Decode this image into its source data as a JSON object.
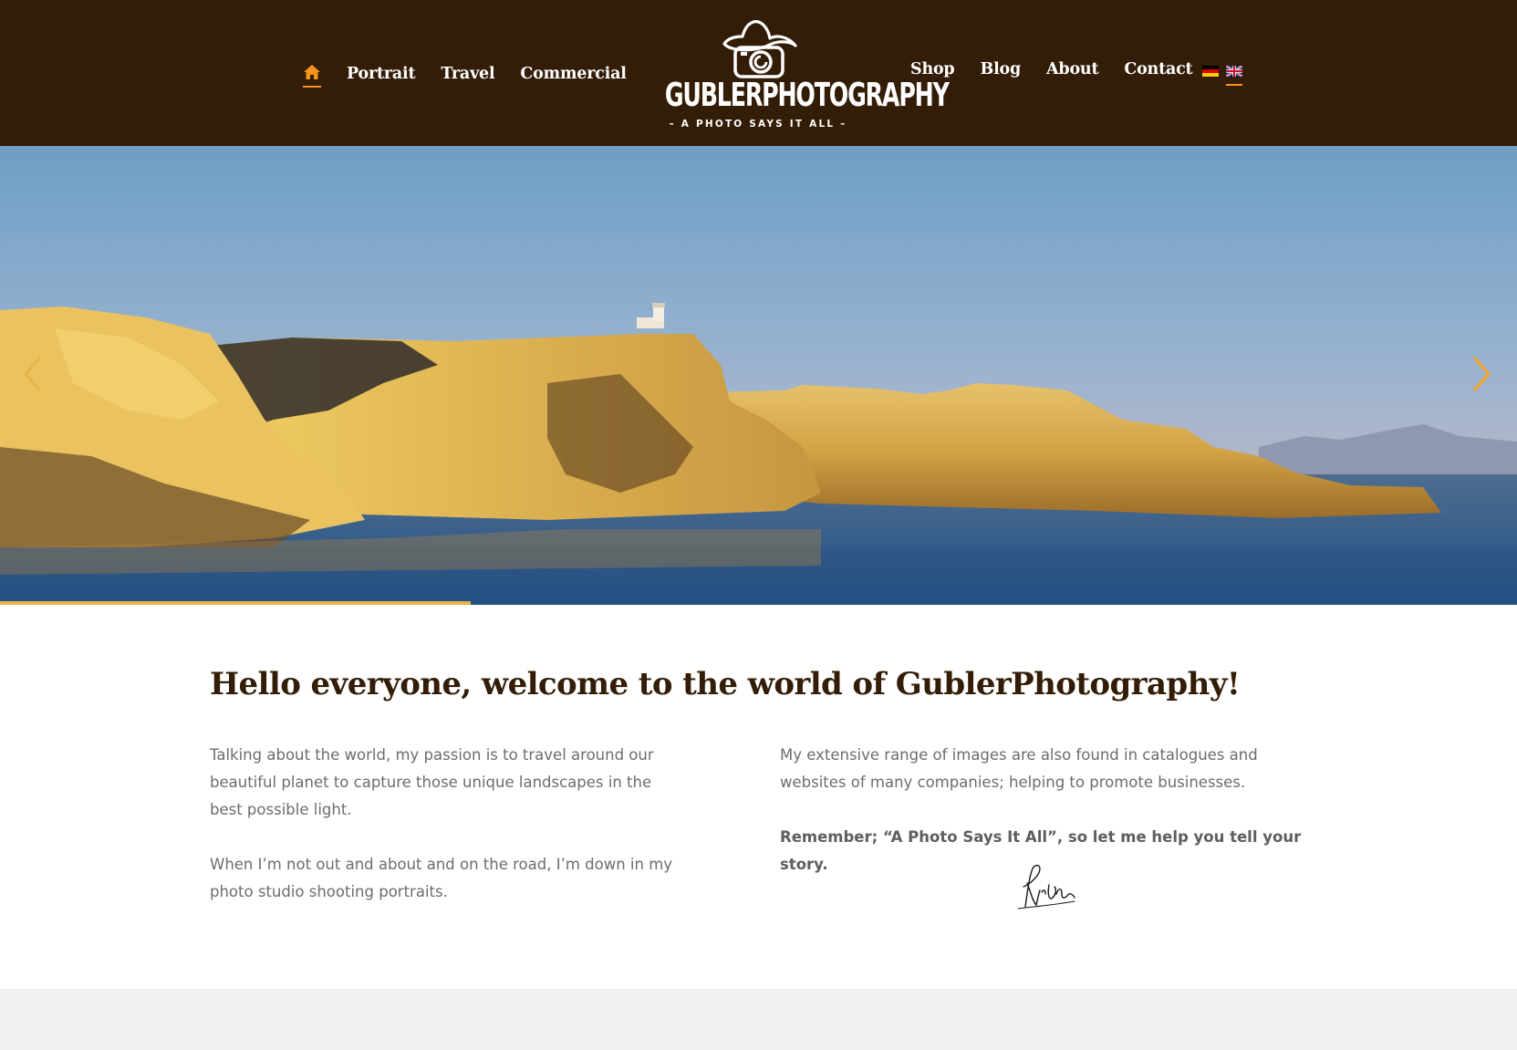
{
  "header": {
    "nav_left": [
      {
        "label": "Portrait"
      },
      {
        "label": "Travel"
      },
      {
        "label": "Commercial"
      }
    ],
    "nav_right": [
      {
        "label": "Shop"
      },
      {
        "label": "Blog"
      },
      {
        "label": "About"
      },
      {
        "label": "Contact"
      }
    ],
    "logo": {
      "wordmark": "GUBLERPHOTOGRAPHY",
      "tagline": "– A PHOTO SAYS IT ALL –"
    },
    "languages": [
      {
        "code": "de",
        "icon": "flag-germany-icon"
      },
      {
        "code": "en",
        "icon": "flag-uk-icon",
        "active": true
      }
    ],
    "accent_color": "#f7941d",
    "background_color": "#331d07"
  },
  "hero": {
    "image": "coastal-limestone-cliffs-at-sunset",
    "progress": 0.31,
    "progress_color": "#e6b54a"
  },
  "content": {
    "headline": "Hello everyone, welcome to the world of GublerPhotography!",
    "left_paragraphs": [
      "Talking about the world, my passion is to travel around our beautiful planet to capture those unique landscapes in the best possible light.",
      "When I’m not out and about and on the road, I’m down in my photo studio shooting portraits."
    ],
    "right_paragraphs": [
      "My extensive range of images are also found in catalogues and websites of many companies; helping to promote businesses.",
      "Remember; “A Photo Says It All”, so let me help you tell your story."
    ],
    "signature": "Richie"
  }
}
